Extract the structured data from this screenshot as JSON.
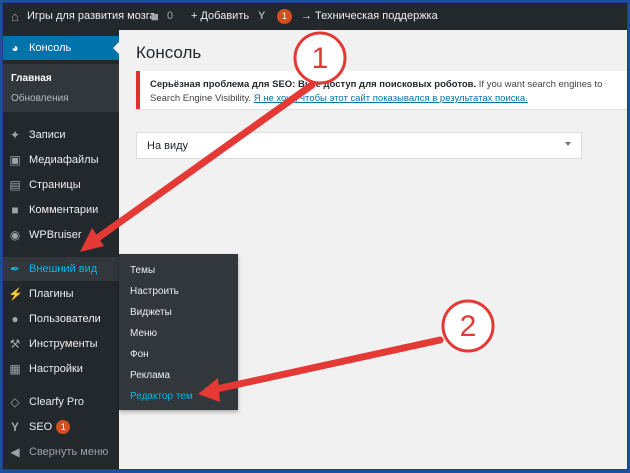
{
  "adminbar": {
    "site_name": "Игры для развития мозга",
    "comments_count": "0",
    "add_label": "+ Добавить",
    "yoast_badge": "1",
    "support_label": "→ Техническая поддержка"
  },
  "sidebar": {
    "console": "Консоль",
    "sub_main": "Главная",
    "sub_updates": "Обновления",
    "posts": "Записи",
    "media": "Медиафайлы",
    "pages": "Страницы",
    "comments": "Комментарии",
    "wpbruiser": "WPBruiser",
    "appearance": "Внешний вид",
    "plugins": "Плагины",
    "users": "Пользователи",
    "tools": "Инструменты",
    "settings": "Настройки",
    "clearfy": "Clearfy Pro",
    "seo": "SEO",
    "seo_badge": "1",
    "collapse": "Свернуть меню"
  },
  "flyout": {
    "themes": "Темы",
    "customize": "Настроить",
    "widgets": "Виджеты",
    "menus": "Меню",
    "background": "Фон",
    "ads": "Реклама",
    "editor": "Редактор тем"
  },
  "main": {
    "title": "Консоль",
    "notice_bold": "Серьёзная проблема для SEO: Вы ",
    "notice_rest": "е доступ для поисковых роботов.",
    "notice_tail": " If you want search engines to",
    "notice_line2": "Search Engine Visibility.",
    "notice_link": "Я не хочу, чтобы этот сайт показывался в результатах поиска.",
    "select_value": "На виду"
  },
  "annotations": {
    "marker1": "1",
    "marker2": "2"
  },
  "colors": {
    "accent": "#0073aa",
    "hover": "#00b9eb",
    "alert": "#dc3232",
    "annotation": "#e53935",
    "border": "#1f4e9c"
  }
}
